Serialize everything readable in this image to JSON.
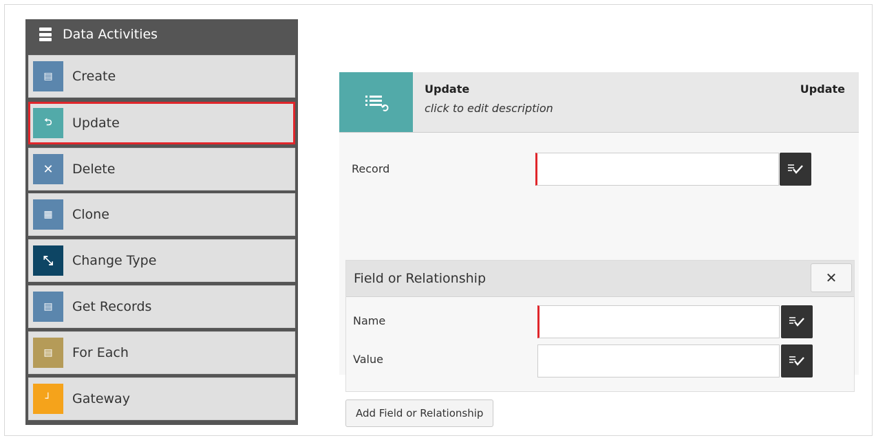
{
  "palette": {
    "title": "Data Activities",
    "icon": "data-activities-icon",
    "items": [
      {
        "label": "Create",
        "icon": "create-icon",
        "color": "#5b86ad",
        "glyph": "▤"
      },
      {
        "label": "Update",
        "icon": "update-icon",
        "color": "#52aaa9",
        "glyph": "⮌",
        "selected": true
      },
      {
        "label": "Delete",
        "icon": "delete-icon",
        "color": "#5b86ad",
        "glyph": "✕"
      },
      {
        "label": "Clone",
        "icon": "clone-icon",
        "color": "#5b86ad",
        "glyph": "▦"
      },
      {
        "label": "Change Type",
        "icon": "change-type-icon",
        "color": "#0d4564",
        "glyph": "⤡"
      },
      {
        "label": "Get Records",
        "icon": "get-records-icon",
        "color": "#5b86ad",
        "glyph": "▤"
      },
      {
        "label": "For Each",
        "icon": "for-each-icon",
        "color": "#b59b58",
        "glyph": "▤"
      },
      {
        "label": "Gateway",
        "icon": "gateway-icon",
        "color": "#f5a31b",
        "glyph": "┘"
      }
    ],
    "selected_color": "#e0262b"
  },
  "editor": {
    "title": "Update",
    "description": "click to edit description",
    "type_label": "Update",
    "icon": "update-list-icon",
    "accent": "#52aaa9",
    "record": {
      "label": "Record",
      "value": "",
      "placeholder": ""
    },
    "group": {
      "title": "Field or Relationship",
      "close_icon": "close-icon",
      "close_glyph": "✕",
      "name": {
        "label": "Name",
        "value": "",
        "placeholder": ""
      },
      "value": {
        "label": "Value",
        "value": "",
        "placeholder": ""
      }
    },
    "add_button": "Add Field or Relationship",
    "picker_icon": "variable-picker-icon"
  }
}
